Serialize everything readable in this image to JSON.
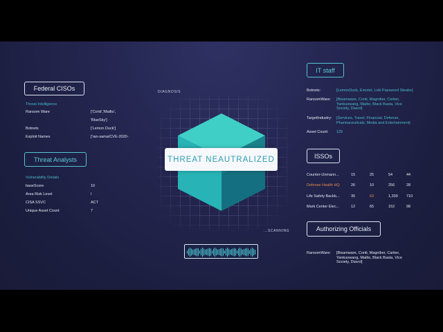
{
  "left": {
    "federal_cisos_button": "Federal CISOs",
    "threat_intel": {
      "title": "Threat Intelligence",
      "rows": [
        {
          "label": "Ransom Ware",
          "value": "['Conti','Mailto',",
          "value2": "'BlueSky']"
        },
        {
          "label": "Botnets",
          "value": "['Lemon Duck']"
        },
        {
          "label": "Exploit Names",
          "value": "['ran-sama/CVE-2020-"
        }
      ]
    },
    "threat_analysts_button": "Threat Analysts",
    "vuln": {
      "title": "Vulnerability Details",
      "rows": [
        {
          "label": "baseScore",
          "value": "10"
        },
        {
          "label": "Area Risk Level",
          "value": "I"
        },
        {
          "label": "CISA SSVC",
          "value": "ACT"
        },
        {
          "label": "Unique Asset Count",
          "value": "7"
        }
      ]
    }
  },
  "center": {
    "diagnosis_label": "DIAGNOSIS",
    "scanning_label": "...SCANNING",
    "banner": "THREAT NEAUTRALIZED"
  },
  "right": {
    "it_staff_button": "IT staff",
    "it_staff": {
      "botnets_label": "Botnets:",
      "botnets_value": "[LemonDuck, Emotet, Loki Password Stealer]",
      "ransomware_label": "RansomWare:",
      "ransomware_value": "[Bisamware, Conti, Magniber, Cerber, Yankuowang, Mailto, Black Basta, Vice Society, Diavol]",
      "target_label": "TargetIndustry:",
      "target_value": "[Services, Travel, Financial, Defense, Pharmaceuticals, Media and Entertainment]",
      "asset_label": "Asset Count:",
      "asset_value": "125"
    },
    "issos_button": "ISSOs",
    "issos_rows": [
      {
        "name": "Counter-Unmann...",
        "c1": "15",
        "c2": "25",
        "c3": "54",
        "c4": "44",
        "highlight": false
      },
      {
        "name": "Defense Health HQ",
        "c1": "26",
        "c2": "10",
        "c3": "256",
        "c4": "28",
        "highlight": true
      },
      {
        "name": "Life Safety Backb...",
        "c1": "35",
        "c2": "63",
        "c3": "1,339",
        "c4": "710",
        "highlight": false
      },
      {
        "name": "Mark Center Elec...",
        "c1": "12",
        "c2": "65",
        "c3": "152",
        "c4": "98",
        "highlight": false
      }
    ],
    "ao_button": "Authorizing Officials",
    "ao": {
      "label": "RansomWare:",
      "value": "[Bisamware, Conti, Magniber, Carber, Yankuowang, Mailto, Black Basta, Vice Society, Diavol]"
    }
  },
  "colors": {
    "accent_teal": "#46b9c9",
    "highlight_orange": "#e58a4a",
    "cube_top": "#3fd0c8",
    "cube_left": "#27b3b7",
    "cube_right": "#15707f"
  }
}
